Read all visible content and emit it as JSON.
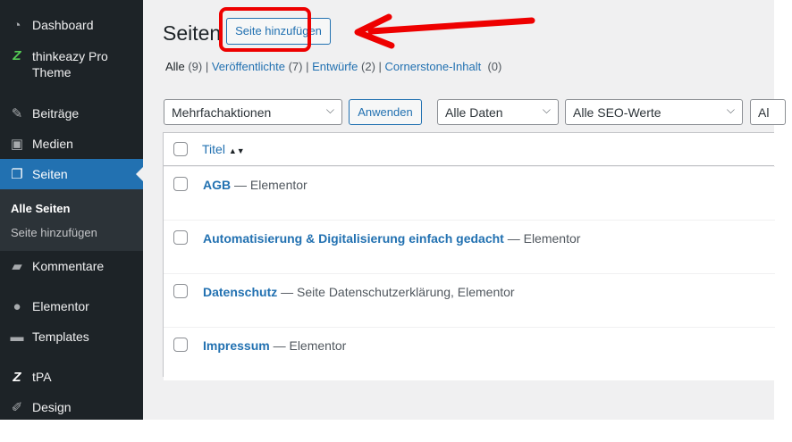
{
  "sidebar": {
    "items": [
      {
        "label": "Dashboard",
        "icon": "dashboard-icon"
      },
      {
        "label": "thinkeazy Pro Theme",
        "icon": "thinkeazy-logo-icon"
      },
      {
        "label": "Beiträge",
        "icon": "pin-icon"
      },
      {
        "label": "Medien",
        "icon": "media-icon"
      },
      {
        "label": "Seiten",
        "icon": "pages-icon"
      },
      {
        "label": "Kommentare",
        "icon": "comment-icon"
      },
      {
        "label": "Elementor",
        "icon": "elementor-icon"
      },
      {
        "label": "Templates",
        "icon": "folder-icon"
      },
      {
        "label": "tPA",
        "icon": "tpa-logo-icon"
      },
      {
        "label": "Design",
        "icon": "brush-icon"
      }
    ],
    "submenu": [
      "Alle Seiten",
      "Seite hinzufügen"
    ]
  },
  "header": {
    "title": "Seiten",
    "add_button": "Seite hinzufügen"
  },
  "views": [
    {
      "label": "Alle",
      "count": "(9)"
    },
    {
      "label": "Veröffentlichte",
      "count": "(7)"
    },
    {
      "label": "Entwürfe",
      "count": "(2)"
    },
    {
      "label": "Cornerstone-Inhalt",
      "count": "(0)"
    }
  ],
  "filters": {
    "bulk": "Mehrfachaktionen",
    "apply": "Anwenden",
    "dates": "Alle Daten",
    "seo": "Alle SEO-Werte",
    "more": "Al"
  },
  "table": {
    "column": "Titel",
    "rows": [
      {
        "title": "AGB",
        "state": " — Elementor"
      },
      {
        "title": "Automatisierung & Digitalisierung einfach gedacht",
        "state": " — Elementor"
      },
      {
        "title": "Datenschutz",
        "state": " — Seite Datenschutzerklärung, Elementor"
      },
      {
        "title": "Impressum",
        "state": " — Elementor"
      }
    ]
  },
  "colors": {
    "accent": "#2271b1",
    "sidebar": "#1d2327",
    "highlight": "#e00000"
  }
}
